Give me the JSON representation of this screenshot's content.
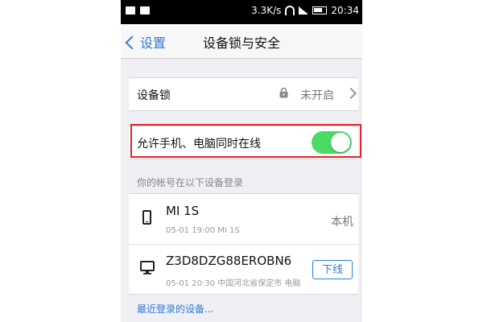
{
  "statusbar": {
    "speed": "3.3K/s",
    "time": "20:34"
  },
  "navbar": {
    "back_label": "设置",
    "title": "设备锁与安全"
  },
  "device_lock": {
    "label": "设备锁",
    "status": "未开启"
  },
  "allow_multi_online": {
    "label": "允许手机、电脑同时在线",
    "enabled": true,
    "highlight_color": "#e0242a",
    "switch_color": "#4cd964"
  },
  "devices_section": {
    "header": "你的帐号在以下设备登录",
    "devices": [
      {
        "name": "MI 1S",
        "detail": "05-01 19:00 MI 1S",
        "tag": "本机",
        "icon": "phone-icon"
      },
      {
        "name": "Z3D8DZG88EROBN6",
        "detail": "05-01 20:30 中国河北省保定市 电脑",
        "action": "下线",
        "icon": "computer-icon"
      }
    ]
  },
  "recent_link": "最近登录的设备..."
}
